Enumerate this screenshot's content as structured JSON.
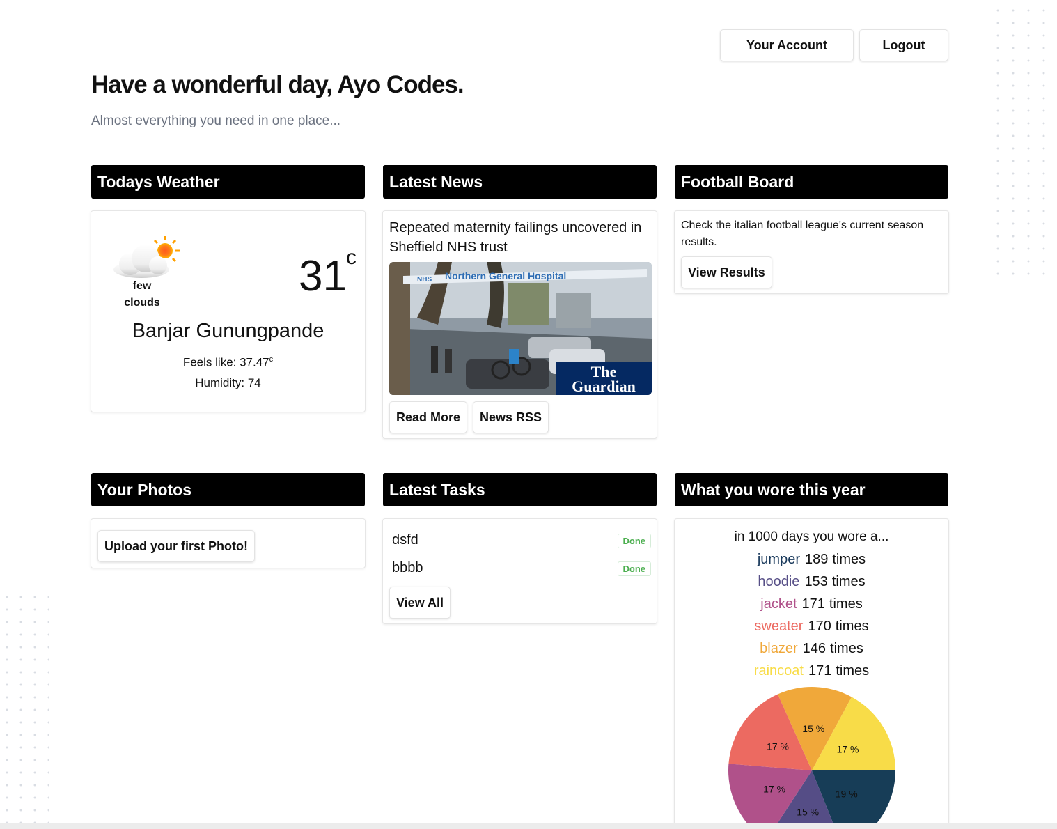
{
  "header": {
    "account_button": "Your Account",
    "logout_button": "Logout",
    "greeting": "Have a wonderful day,  Ayo Codes.",
    "subtitle": "Almost everything you need in one place..."
  },
  "weather": {
    "title": "Todays Weather",
    "condition_line1": "few",
    "condition_line2": "clouds",
    "temperature": "31",
    "temp_unit": "c",
    "city": "Banjar Gunungpande",
    "feels_like_label": "Feels like: 37.47",
    "feels_like_unit": "c",
    "humidity": "Humidity: 74",
    "icon": "partly-cloudy-sun-icon"
  },
  "news": {
    "title": "Latest News",
    "headline": "Repeated maternity failings uncovered in Sheffield NHS trust",
    "image_sign_text": "Northern General Hospital",
    "image_sign_badge": "NHS",
    "image_logo_line1": "The",
    "image_logo_line2": "Guardian",
    "read_more_button": "Read More",
    "rss_button": "News RSS"
  },
  "football": {
    "title": "Football Board",
    "description": "Check the italian football league's current season results.",
    "view_results_button": "View Results"
  },
  "photos": {
    "title": "Your Photos",
    "upload_button": "Upload your first Photo!"
  },
  "tasks": {
    "title": "Latest Tasks",
    "items": [
      {
        "name": "dsfd",
        "status": "Done"
      },
      {
        "name": "bbbb",
        "status": "Done"
      }
    ],
    "view_all_button": "View All"
  },
  "wore": {
    "title": "What you wore this year",
    "intro": "in 1000 days you wore a...",
    "times_label": "times",
    "items": [
      {
        "name": "jumper",
        "count": "189",
        "color": "#1a3a5c"
      },
      {
        "name": "hoodie",
        "count": "153",
        "color": "#574f87"
      },
      {
        "name": "jacket",
        "count": "171",
        "color": "#b0518a"
      },
      {
        "name": "sweater",
        "count": "170",
        "color": "#ec6a61"
      },
      {
        "name": "blazer",
        "count": "146",
        "color": "#f0a83a"
      },
      {
        "name": "raincoat",
        "count": "171",
        "color": "#f8dc48"
      }
    ]
  },
  "chart_data": {
    "type": "pie",
    "categories": [
      "jumper",
      "hoodie",
      "jacket",
      "sweater",
      "blazer",
      "raincoat"
    ],
    "values": [
      189,
      153,
      171,
      170,
      146,
      171
    ],
    "labels": [
      "19 %",
      "15 %",
      "17 %",
      "17 %",
      "15 %",
      "17 %"
    ],
    "colors": [
      "#173d57",
      "#554d86",
      "#b0518a",
      "#ec6a61",
      "#f0a83a",
      "#f8dc48"
    ]
  }
}
